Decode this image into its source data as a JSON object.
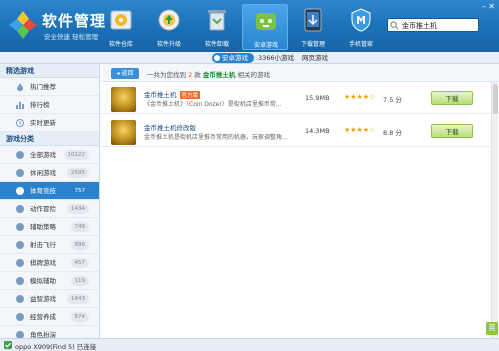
{
  "app": {
    "title": "软件管理",
    "slogan": "安全快速 轻松管理"
  },
  "nav": [
    {
      "label": "软件仓库",
      "icon": "software-store-icon"
    },
    {
      "label": "软件升级",
      "icon": "software-upgrade-icon"
    },
    {
      "label": "软件卸载",
      "icon": "software-uninstall-icon"
    },
    {
      "label": "安卓游戏",
      "icon": "android-games-icon"
    },
    {
      "label": "下载管理",
      "icon": "download-manager-icon"
    },
    {
      "label": "手机管家",
      "icon": "phone-manager-icon"
    }
  ],
  "search": {
    "value": "金币推土机"
  },
  "subbar": {
    "selected": "安卓游戏",
    "count_text": "3366小游戏",
    "web_games": "网页游戏"
  },
  "sidebar": {
    "section1": "精选游戏",
    "featured": [
      {
        "label": "热门推荐",
        "icon": "flame-icon"
      },
      {
        "label": "排行榜",
        "icon": "ranking-icon"
      },
      {
        "label": "实时更新",
        "icon": "clock-icon"
      }
    ],
    "section2": "游戏分类",
    "categories": [
      {
        "label": "全部游戏",
        "count": "10122",
        "icon": "grid-icon"
      },
      {
        "label": "休闲游戏",
        "count": "2595",
        "icon": "casual-icon"
      },
      {
        "label": "体育竞技",
        "count": "757",
        "icon": "sports-icon",
        "active": true
      },
      {
        "label": "动作冒险",
        "count": "1434",
        "icon": "action-icon"
      },
      {
        "label": "辅助策略",
        "count": "749",
        "icon": "strategy-icon"
      },
      {
        "label": "射击飞行",
        "count": "896",
        "icon": "shooting-icon"
      },
      {
        "label": "棋牌游戏",
        "count": "457",
        "icon": "chess-icon"
      },
      {
        "label": "模拟辅助",
        "count": "119",
        "icon": "simulation-icon"
      },
      {
        "label": "益智游戏",
        "count": "1443",
        "icon": "puzzle-icon"
      },
      {
        "label": "经营养成",
        "count": "574",
        "icon": "business-icon"
      },
      {
        "label": "角色扮演",
        "count": "",
        "icon": "roleplay-icon"
      }
    ]
  },
  "crumb": {
    "back": "返回",
    "pre": "一共为您找到",
    "num": "2",
    "mid": "款",
    "keyword": "金币推土机",
    "post": "相关的游戏"
  },
  "results": [
    {
      "name": "金币推土机",
      "badge": "官方版",
      "desc": "《金币推土机》（Coin Dozer）是街机店里推币常...",
      "size": "15.9MB",
      "stars": "★★★★☆",
      "score": "7.5 分",
      "download": "下载"
    },
    {
      "name": "金币推土机修改版",
      "badge": "",
      "desc": "金币推土机是街机店里推币常用的机器，玩家调整角...",
      "size": "14.3MB",
      "stars": "★★★★☆",
      "score": "8.8 分",
      "download": "下载"
    }
  ],
  "status": {
    "device": "oppo X909(Find 5) 已连接"
  },
  "ime": "英",
  "colors": {
    "header": "#1a6fb5",
    "accent": "#2b83cd",
    "download_btn": "#b8dc7a",
    "badge": "#f06a1a"
  }
}
